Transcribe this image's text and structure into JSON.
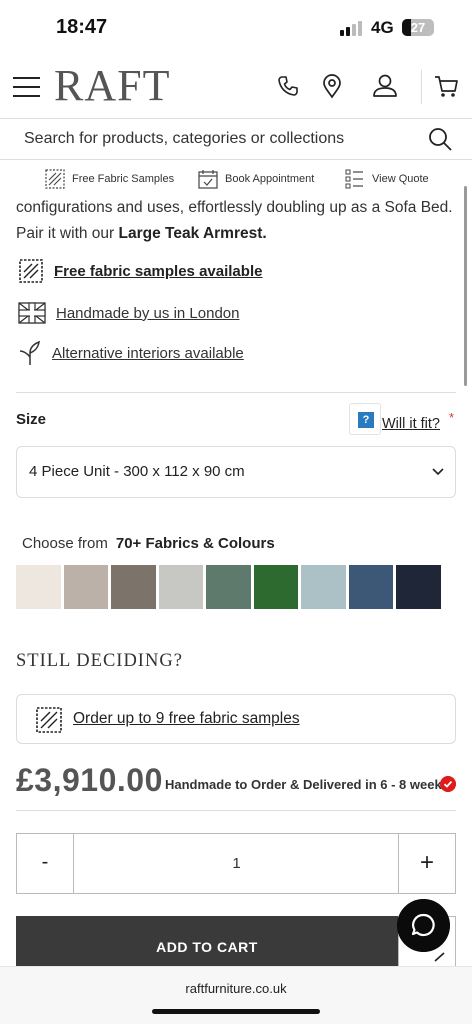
{
  "status_bar": {
    "time": "18:47",
    "network": "4G",
    "battery": "27"
  },
  "header": {
    "logo": "RAFT",
    "icons": [
      "menu-icon",
      "phone-icon",
      "location-pin-icon",
      "user-icon",
      "cart-icon"
    ]
  },
  "search": {
    "placeholder": "Search for products, categories or collections"
  },
  "utility_bar": {
    "free_samples": "Free Fabric Samples",
    "book_appointment": "Book Appointment",
    "view_quote": "View Quote"
  },
  "description": {
    "line1": "configurations and uses, effortlessly doubling up as a Sofa Bed.",
    "line2_prefix": "Pair it with our ",
    "line2_link": "Large Teak Armrest."
  },
  "features": {
    "samples": "Free fabric samples available",
    "handmade": "Handmade by us in London",
    "alternative": "Alternative interiors available"
  },
  "size": {
    "label": "Size",
    "will_it_fit": "Will it fit?",
    "required_mark": "*",
    "help_icon_text": "?",
    "selected": "4 Piece Unit - 300 x 112 x 90 cm"
  },
  "fabrics": {
    "prefix": "Choose from",
    "count_label": "70+ Fabrics & Colours",
    "swatches": [
      "#ede7df",
      "#bcb1a8",
      "#7c746b",
      "#c7c8c4",
      "#5e7a6d",
      "#2c6a2f",
      "#abc1c6",
      "#3d5777",
      "#1e2638"
    ]
  },
  "still_deciding": {
    "heading": "STILL DECIDING?",
    "order_samples": "Order up to 9 free fabric samples"
  },
  "price": {
    "amount": "£3,910.00",
    "delivery": "Handmade to Order & Delivered in 6 - 8 weeks"
  },
  "quantity": {
    "minus": "-",
    "value": "1",
    "plus": "+"
  },
  "cart": {
    "add_label": "ADD TO CART"
  },
  "browser": {
    "url": "raftfurniture.co.uk"
  }
}
